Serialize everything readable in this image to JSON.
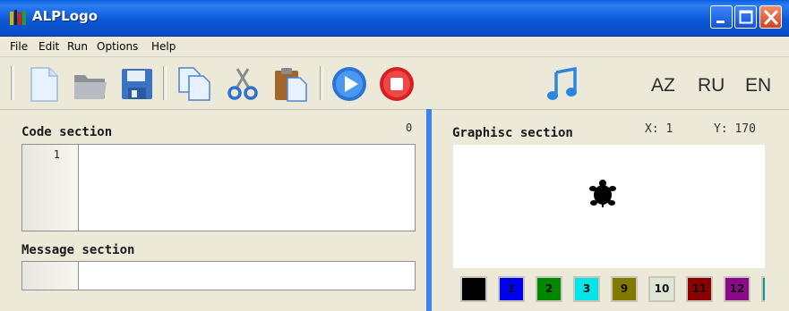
{
  "window": {
    "title": "ALPLogo"
  },
  "menu": {
    "items": [
      "File",
      "Edit",
      "Run",
      "Options",
      "Help"
    ]
  },
  "toolbar": {
    "icons": [
      "new-file-icon",
      "open-folder-icon",
      "save-icon",
      "copy-icon",
      "cut-icon",
      "paste-icon",
      "run-icon",
      "stop-icon",
      "music-icon"
    ],
    "languages": [
      "AZ",
      "RU",
      "EN"
    ]
  },
  "code_section": {
    "title": "Code section",
    "counter": "0",
    "line_numbers": [
      "1"
    ]
  },
  "message_section": {
    "title": "Message section"
  },
  "graphics_section": {
    "title": "Graphisc section",
    "x_label": "X: 1",
    "y_label": "Y: 170"
  },
  "palette": [
    {
      "label": "",
      "color": "#000000"
    },
    {
      "label": "1",
      "color": "#0000ee"
    },
    {
      "label": "2",
      "color": "#008800"
    },
    {
      "label": "3",
      "color": "#00e6e6"
    },
    {
      "label": "9",
      "color": "#807a00"
    },
    {
      "label": "10",
      "color": "#dfe6d6"
    },
    {
      "label": "11",
      "color": "#8a0000"
    },
    {
      "label": "12",
      "color": "#8a0a8a"
    }
  ]
}
